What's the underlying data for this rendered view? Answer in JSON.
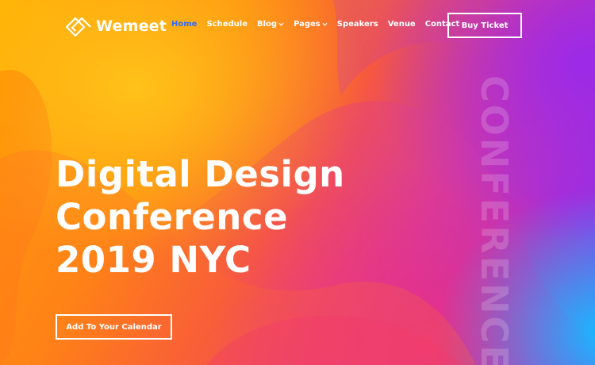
{
  "brand": {
    "name": "Wemeet",
    "logo_icon": "wemeet-logo-icon"
  },
  "nav": {
    "items": [
      {
        "label": "Home",
        "active": true,
        "dropdown": false
      },
      {
        "label": "Schedule",
        "active": false,
        "dropdown": false
      },
      {
        "label": "Blog",
        "active": false,
        "dropdown": true
      },
      {
        "label": "Pages",
        "active": false,
        "dropdown": true
      },
      {
        "label": "Speakers",
        "active": false,
        "dropdown": false
      },
      {
        "label": "Venue",
        "active": false,
        "dropdown": false
      },
      {
        "label": "Contact",
        "active": false,
        "dropdown": false
      }
    ],
    "cta_label": "Buy Ticket",
    "active_color": "#2f6cff"
  },
  "hero": {
    "headline_lines": [
      "Digital Design",
      "Conference",
      "2019 NYC"
    ],
    "calendar_button_label": "Add To Your Calendar",
    "vertical_watermark": "CONFERENCE"
  },
  "colors": {
    "yellow": "#ffc21a",
    "orange": "#ff8a10",
    "pink": "#f02a7e",
    "purple": "#9b2ae8",
    "blue": "#1ab8ff"
  }
}
